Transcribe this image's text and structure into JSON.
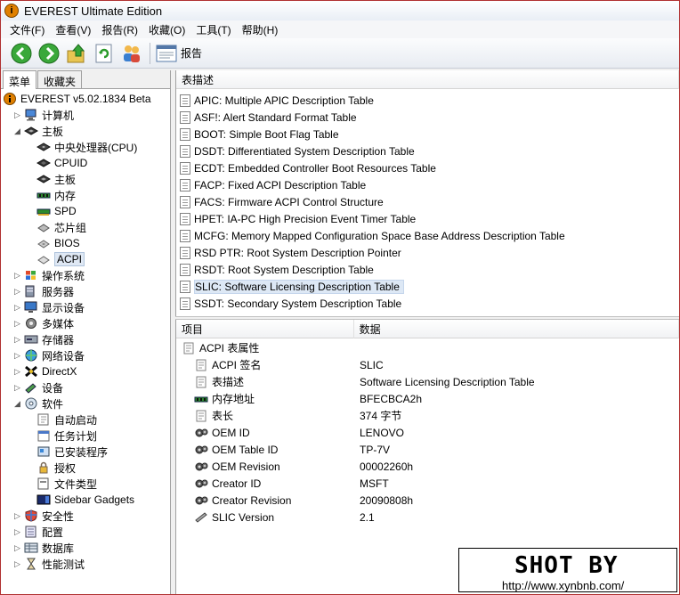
{
  "window": {
    "title": "EVEREST Ultimate Edition"
  },
  "menu": [
    "文件(F)",
    "查看(V)",
    "报告(R)",
    "收藏(O)",
    "工具(T)",
    "帮助(H)"
  ],
  "toolbar": {
    "report_label": "报告"
  },
  "tabs": [
    "菜单",
    "收藏夹"
  ],
  "tree": [
    {
      "label": "EVEREST v5.02.1834 Beta",
      "level": 0,
      "icon": "info-icon",
      "exp": ""
    },
    {
      "label": "计算机",
      "level": 1,
      "icon": "computer-icon",
      "exp": "▷"
    },
    {
      "label": "主板",
      "level": 1,
      "icon": "motherboard-icon",
      "exp": "◢"
    },
    {
      "label": "中央处理器(CPU)",
      "level": 2,
      "icon": "cpu-icon",
      "exp": ""
    },
    {
      "label": "CPUID",
      "level": 2,
      "icon": "cpuid-icon",
      "exp": ""
    },
    {
      "label": "主板",
      "level": 2,
      "icon": "motherboard-icon",
      "exp": ""
    },
    {
      "label": "内存",
      "level": 2,
      "icon": "memory-icon",
      "exp": ""
    },
    {
      "label": "SPD",
      "level": 2,
      "icon": "spd-icon",
      "exp": ""
    },
    {
      "label": "芯片组",
      "level": 2,
      "icon": "chipset-icon",
      "exp": ""
    },
    {
      "label": "BIOS",
      "level": 2,
      "icon": "bios-icon",
      "exp": ""
    },
    {
      "label": "ACPI",
      "level": 2,
      "icon": "acpi-icon",
      "exp": "",
      "selected": true
    },
    {
      "label": "操作系统",
      "level": 1,
      "icon": "windows-icon",
      "exp": "▷"
    },
    {
      "label": "服务器",
      "level": 1,
      "icon": "server-icon",
      "exp": "▷"
    },
    {
      "label": "显示设备",
      "level": 1,
      "icon": "display-icon",
      "exp": "▷"
    },
    {
      "label": "多媒体",
      "level": 1,
      "icon": "multimedia-icon",
      "exp": "▷"
    },
    {
      "label": "存储器",
      "level": 1,
      "icon": "storage-icon",
      "exp": "▷"
    },
    {
      "label": "网络设备",
      "level": 1,
      "icon": "network-icon",
      "exp": "▷"
    },
    {
      "label": "DirectX",
      "level": 1,
      "icon": "directx-icon",
      "exp": "▷"
    },
    {
      "label": "设备",
      "level": 1,
      "icon": "devices-icon",
      "exp": "▷"
    },
    {
      "label": "软件",
      "level": 1,
      "icon": "software-icon",
      "exp": "◢"
    },
    {
      "label": "自动启动",
      "level": 2,
      "icon": "startup-icon",
      "exp": ""
    },
    {
      "label": "任务计划",
      "level": 2,
      "icon": "scheduler-icon",
      "exp": ""
    },
    {
      "label": "已安装程序",
      "level": 2,
      "icon": "installed-programs-icon",
      "exp": ""
    },
    {
      "label": "授权",
      "level": 2,
      "icon": "license-icon",
      "exp": ""
    },
    {
      "label": "文件类型",
      "level": 2,
      "icon": "file-types-icon",
      "exp": ""
    },
    {
      "label": "Sidebar Gadgets",
      "level": 2,
      "icon": "gadgets-icon",
      "exp": ""
    },
    {
      "label": "安全性",
      "level": 1,
      "icon": "security-icon",
      "exp": "▷"
    },
    {
      "label": "配置",
      "level": 1,
      "icon": "config-icon",
      "exp": "▷"
    },
    {
      "label": "数据库",
      "level": 1,
      "icon": "database-icon",
      "exp": "▷"
    },
    {
      "label": "性能测试",
      "level": 1,
      "icon": "benchmark-icon",
      "exp": "▷"
    }
  ],
  "top_list": {
    "header": "表描述",
    "rows": [
      "APIC: Multiple APIC Description Table",
      "ASF!: Alert Standard Format Table",
      "BOOT: Simple Boot Flag Table",
      "DSDT: Differentiated System Description Table",
      "ECDT: Embedded Controller Boot Resources Table",
      "FACP: Fixed ACPI Description Table",
      "FACS: Firmware ACPI Control Structure",
      "HPET: IA-PC High Precision Event Timer Table",
      "MCFG: Memory Mapped Configuration Space Base Address Description Table",
      "RSD PTR: Root System Description Pointer",
      "RSDT: Root System Description Table",
      "SLIC: Software Licensing Description Table",
      "SSDT: Secondary System Description Table"
    ],
    "selected_index": 11
  },
  "bottom_table": {
    "headers": [
      "项目",
      "数据"
    ],
    "group": "ACPI 表属性",
    "rows": [
      {
        "name": "ACPI 签名",
        "value": "SLIC",
        "icon": "doc-icon"
      },
      {
        "name": "表描述",
        "value": "Software Licensing Description Table",
        "icon": "doc-icon"
      },
      {
        "name": "内存地址",
        "value": "BFECBCA2h",
        "icon": "memory-icon"
      },
      {
        "name": "表长",
        "value": "374 字节",
        "icon": "doc-icon"
      },
      {
        "name": "OEM ID",
        "value": "LENOVO",
        "icon": "gear-icon"
      },
      {
        "name": "OEM Table ID",
        "value": "TP-7V",
        "icon": "gear-icon"
      },
      {
        "name": "OEM Revision",
        "value": "00002260h",
        "icon": "gear-icon"
      },
      {
        "name": "Creator ID",
        "value": "MSFT",
        "icon": "gear-icon"
      },
      {
        "name": "Creator Revision",
        "value": "20090808h",
        "icon": "gear-icon"
      },
      {
        "name": "SLIC Version",
        "value": "2.1",
        "icon": "slic-icon"
      }
    ]
  },
  "watermark": {
    "title": "SHOT BY",
    "url": "http://www.xynbnb.com/"
  }
}
